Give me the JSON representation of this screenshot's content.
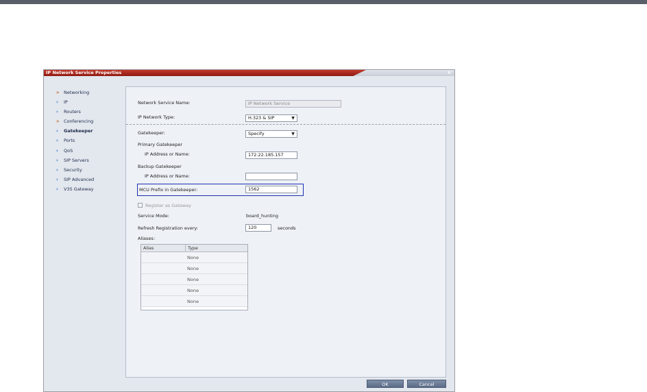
{
  "dialog": {
    "title": "IP Network Service Properties",
    "close_icon": "×"
  },
  "nav": {
    "items": [
      {
        "label": "Networking",
        "icon": "double-chevron-icon",
        "active": false
      },
      {
        "label": "IP",
        "icon": "chevron-icon",
        "active": false
      },
      {
        "label": "Routers",
        "icon": "chevron-icon",
        "active": false
      },
      {
        "label": "Conferencing",
        "icon": "double-chevron-icon",
        "active": false
      },
      {
        "label": "Gatekeeper",
        "icon": "chevron-icon",
        "active": true
      },
      {
        "label": "Ports",
        "icon": "chevron-icon",
        "active": false
      },
      {
        "label": "QoS",
        "icon": "chevron-icon",
        "active": false
      },
      {
        "label": "SIP Servers",
        "icon": "chevron-icon",
        "active": false
      },
      {
        "label": "Security",
        "icon": "chevron-icon",
        "active": false
      },
      {
        "label": "SIP Advanced",
        "icon": "chevron-icon",
        "active": false
      },
      {
        "label": "V35 Gateway",
        "icon": "chevron-icon",
        "active": false
      }
    ]
  },
  "form": {
    "network_service_name_label": "Network Service Name:",
    "network_service_name_value": "IP Network Service",
    "ip_network_type_label": "IP Network Type:",
    "ip_network_type_value": "H.323 & SIP",
    "gatekeeper_label": "Gatekeeper:",
    "gatekeeper_value": "Specify",
    "primary_gatekeeper_label": "Primary Gatekeeper",
    "primary_ip_label": "IP Address or Name:",
    "primary_ip_value": "172.22.185.157",
    "backup_gatekeeper_label": "Backup Gatekeeper",
    "backup_ip_label": "IP Address or Name:",
    "backup_ip_value": "",
    "mcu_prefix_label": "MCU Prefix in Gatekeeper:",
    "mcu_prefix_value": "1562",
    "register_gateway_label": "Register as Gateway",
    "service_mode_label": "Service Mode:",
    "service_mode_value": "board_hunting",
    "refresh_label": "Refresh Registration every:",
    "refresh_value": "120",
    "refresh_unit": "seconds",
    "aliases_label": "Aliases:"
  },
  "aliases_table": {
    "headers": [
      "Alias",
      "Type"
    ],
    "rows": [
      {
        "alias": "",
        "type": "None"
      },
      {
        "alias": "",
        "type": "None"
      },
      {
        "alias": "",
        "type": "None"
      },
      {
        "alias": "",
        "type": "None"
      },
      {
        "alias": "",
        "type": "None"
      }
    ]
  },
  "buttons": {
    "ok": "OK",
    "cancel": "Cancel"
  },
  "colors": {
    "title_red": "#a8281c",
    "highlight_border": "#1a2fb0",
    "button": "#6b7b96"
  }
}
